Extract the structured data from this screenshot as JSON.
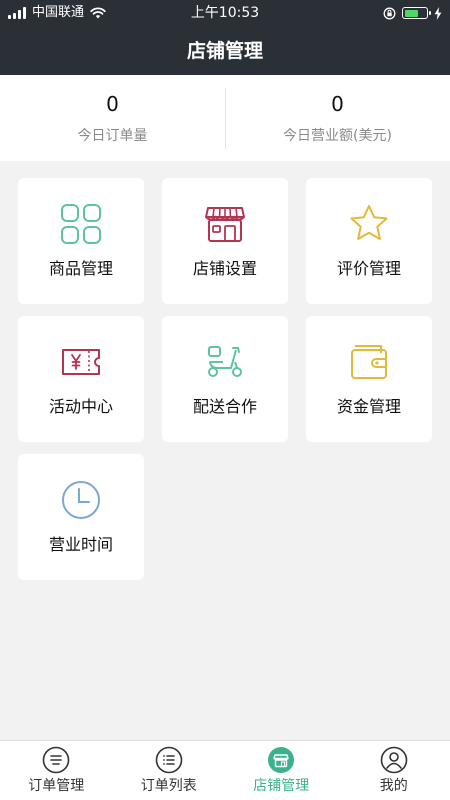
{
  "status_bar": {
    "carrier": "中国联通",
    "time": "上午10:53"
  },
  "header": {
    "title": "店铺管理"
  },
  "stats": [
    {
      "value": "0",
      "label": "今日订单量"
    },
    {
      "value": "0",
      "label": "今日营业额(美元)"
    }
  ],
  "menu": [
    {
      "label": "商品管理",
      "icon": "product-grid-icon",
      "color": "#5fc2a1"
    },
    {
      "label": "店铺设置",
      "icon": "store-icon",
      "color": "#b43552"
    },
    {
      "label": "评价管理",
      "icon": "star-icon",
      "color": "#e2b93b"
    },
    {
      "label": "活动中心",
      "icon": "ticket-icon",
      "color": "#b43552"
    },
    {
      "label": "配送合作",
      "icon": "scooter-icon",
      "color": "#5fc2a1"
    },
    {
      "label": "资金管理",
      "icon": "wallet-icon",
      "color": "#e2b93b"
    },
    {
      "label": "营业时间",
      "icon": "clock-icon",
      "color": "#7aa7d3"
    }
  ],
  "tabs": [
    {
      "label": "订单管理",
      "icon": "order-manage-icon",
      "active": false
    },
    {
      "label": "订单列表",
      "icon": "order-list-icon",
      "active": false
    },
    {
      "label": "店铺管理",
      "icon": "store-manage-icon",
      "active": true
    },
    {
      "label": "我的",
      "icon": "profile-icon",
      "active": false
    }
  ],
  "colors": {
    "header_bg": "#2b2f36",
    "accent": "#3bb28d",
    "battery": "#4cd964"
  }
}
